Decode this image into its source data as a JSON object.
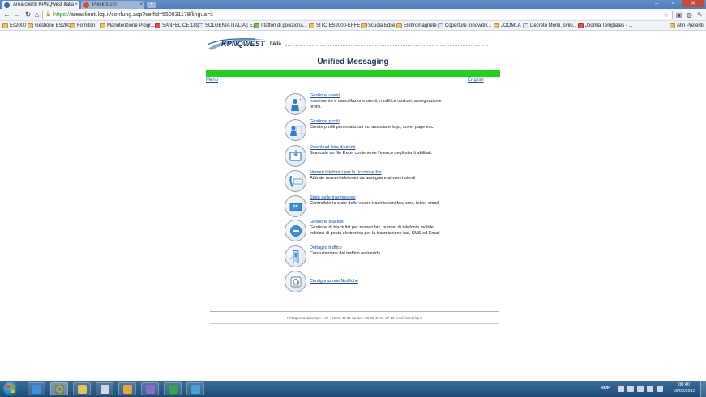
{
  "browser": {
    "tabs": [
      {
        "label": "Area clienti KPNQwest Italia",
        "active": true
      },
      {
        "label": "Plesk 9.2.0",
        "active": false
      }
    ],
    "url_https": "https://",
    "url_rest": "areaclienti.kqi.it/confung.asp?selfId=550831178/lingua=it",
    "bookmarks": [
      {
        "label": "Es2000",
        "icon": "folder-icon"
      },
      {
        "label": "Gestione ES2000",
        "icon": "folder-icon"
      },
      {
        "label": "Fornitori",
        "icon": "folder-icon"
      },
      {
        "label": "Manutenzione Progr...",
        "icon": "folder-icon"
      },
      {
        "label": "SANFELICE 1893",
        "icon": "page-icon"
      },
      {
        "label": "SOLGENIA ITALIA | E...",
        "icon": "page-icon"
      },
      {
        "label": "I fattori di posiziona...",
        "icon": "page-icon"
      },
      {
        "label": "SITO ES2000-EFFETTI",
        "icon": "folder-icon"
      },
      {
        "label": "Scuola Edile",
        "icon": "folder-icon"
      },
      {
        "label": "Elettromagnete",
        "icon": "folder-icon"
      },
      {
        "label": "Coperture Innovativ...",
        "icon": "page-icon"
      },
      {
        "label": "JOOMLA",
        "icon": "folder-icon"
      },
      {
        "label": "Decreto Monti, svilu...",
        "icon": "page-icon"
      },
      {
        "label": "Joomla Templates - ...",
        "icon": "page-icon"
      },
      {
        "label": "Altri Preferiti",
        "icon": "folder-icon"
      }
    ]
  },
  "page": {
    "logo_text": "KPNQWEST",
    "logo_sub": "Italia",
    "title": "Unified Messaging",
    "menu_link": "Menu",
    "language_link": "English",
    "items": [
      {
        "link": "Gestione utenti",
        "desc": "Inserimento e cancellazione utenti, modifica opzioni, assegnazione profili.",
        "icon": "users-icon"
      },
      {
        "link": "Gestione profili",
        "desc": "Create profili personalizzati cui associare logo, cover page ecc.",
        "icon": "profile-icon"
      },
      {
        "link": "Download lista di utenti",
        "desc": "Scaricate un file Excel contenente l'elenco degli utenti abilitati.",
        "icon": "download-icon"
      },
      {
        "link": "Numeri telefonici per la ricezione fax",
        "desc": "Attivate numeri telefonici da assegnare ai vostri utenti",
        "icon": "phone-icon"
      },
      {
        "link": "Stato delle trasmissioni",
        "desc": "Controllate lo stato delle vostre trasmissioni fax, sms, telex, email",
        "icon": "status-icon"
      },
      {
        "link": "Gestione blacklist",
        "desc": "Gestione di black list per numeri fax, numeri di telefonia mobile, indirizzi di posta elettronica per la trasmissione fax, SMS ed Email",
        "icon": "blacklist-icon"
      },
      {
        "link": "Dettaglio traffico",
        "desc": "Consultazione del traffico online/td>",
        "icon": "traffic-icon"
      },
      {
        "link": "Configurazione Notifiche",
        "desc": "",
        "icon": "notification-icon"
      }
    ],
    "footer": "KPNQwest Italia SpA - tel +39 02 43 81 31 fax +39 02 40 01 37 18 email info@kqi.it"
  },
  "taskbar": {
    "lang": "RDP",
    "time": "08:40",
    "date": "15/09/2012"
  }
}
